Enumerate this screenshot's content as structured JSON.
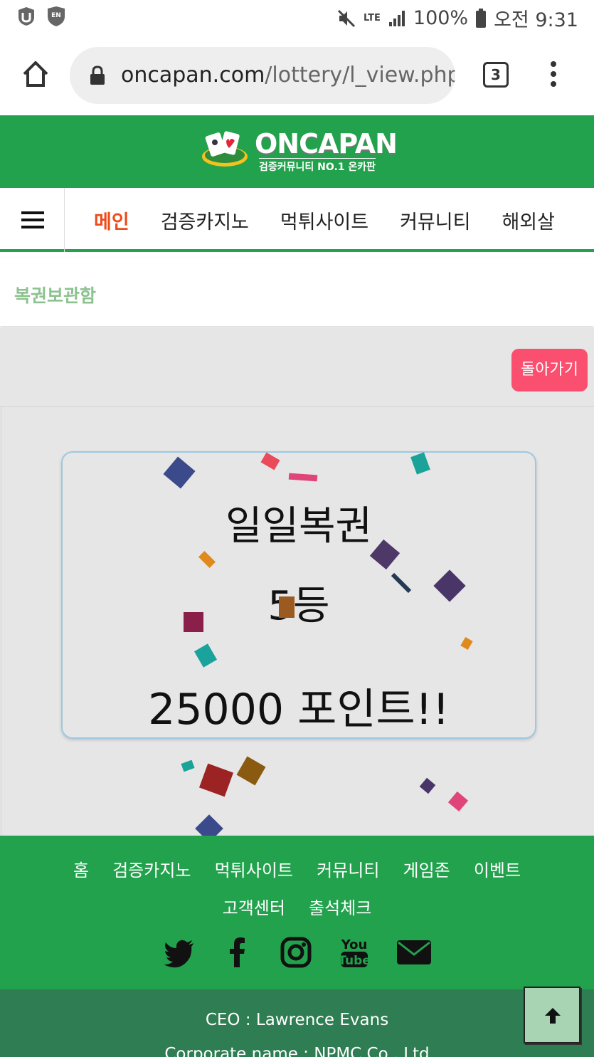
{
  "status_bar": {
    "battery": "100%",
    "time": "오전 9:31",
    "network": "LTE"
  },
  "browser": {
    "url_domain": "oncapan.com",
    "url_path": "/lottery/l_view.php",
    "tab_count": "3"
  },
  "header": {
    "brand": "ONCAPAN",
    "tagline": "검증커뮤니티 NO.1 온카판",
    "brand_color": "#22a24d"
  },
  "nav": {
    "items": [
      {
        "label": "메인",
        "active": true
      },
      {
        "label": "검증카지노"
      },
      {
        "label": "먹튀사이트"
      },
      {
        "label": "커뮤니티"
      },
      {
        "label": "해외살"
      }
    ]
  },
  "breadcrumb": {
    "title": "복권보관함"
  },
  "content": {
    "back_label": "돌아가기",
    "card": {
      "title": "일일복권",
      "rank": "5등",
      "prize": "25000 포인트!!"
    }
  },
  "footer": {
    "links": [
      "홈",
      "검증카지노",
      "먹튀사이트",
      "커뮤니티",
      "게임존",
      "이벤트",
      "고객센터",
      "출석체크"
    ],
    "social": [
      "twitter-icon",
      "facebook-icon",
      "instagram-icon",
      "youtube-icon",
      "email-icon"
    ],
    "ceo": "CEO : Lawrence Evans",
    "corp": "Corporate name : NPMC Co., Ltd"
  }
}
